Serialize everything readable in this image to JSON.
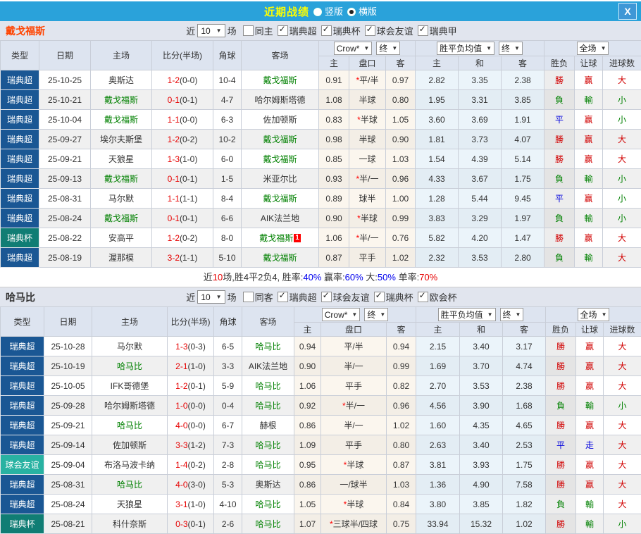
{
  "topbar": {
    "title": "近期战绩",
    "radio_options": [
      {
        "label": "竖版",
        "selected": false,
        "name": "vertical-layout-radio"
      },
      {
        "label": "横版",
        "selected": true,
        "name": "horizontal-layout-radio"
      }
    ],
    "close_glyph": "X"
  },
  "colors": {
    "topbar_bg": "#2aa2da",
    "title_yellow": "#ffff00",
    "focus_team_green": "#008000",
    "score_red": "#e60000",
    "league_bg": {
      "瑞典超": "#1a5794",
      "瑞典杯": "#107d74",
      "球会友谊": "#28b2a2"
    },
    "glyph_colors": {
      "勝": "#d10000",
      "負": "#008000",
      "平": "#0000dd",
      "赢": "#d10000",
      "輸": "#008000",
      "走": "#0000dd",
      "大": "#d10000",
      "小": "#008000"
    }
  },
  "sections": [
    {
      "team": "戴戈福斯",
      "team_color": "#ff4400",
      "filter": {
        "near_label": "近",
        "count": "10",
        "unit_label": "场",
        "same_option": {
          "label": "同主",
          "checked": false
        },
        "leagues": [
          {
            "label": "瑞典超",
            "checked": true
          },
          {
            "label": "瑞典杯",
            "checked": true
          },
          {
            "label": "球会友谊",
            "checked": true
          },
          {
            "label": "瑞典甲",
            "checked": true
          }
        ]
      },
      "header": {
        "columns": [
          "类型",
          "日期",
          "主场",
          "比分(半场)",
          "角球",
          "客场"
        ],
        "groups": [
          {
            "dropdowns": [
              "Crow*",
              "终"
            ]
          },
          {
            "dropdowns": [
              "胜平负均值",
              "终"
            ]
          },
          {
            "dropdowns": [
              "全场"
            ]
          }
        ],
        "sub_columns": [
          "主",
          "盘口",
          "客",
          "主",
          "和",
          "客",
          "胜负",
          "让球",
          "进球数"
        ]
      },
      "rows": [
        {
          "league": "瑞典超",
          "date": "25-10-25",
          "home": "奥斯达",
          "home_focus": false,
          "score": "1-2",
          "half": "(0-0)",
          "corner": "10-4",
          "away": "戴戈福斯",
          "away_focus": true,
          "odds_home": "0.91",
          "handicap_star": true,
          "handicap": "平/半",
          "odds_away": "0.97",
          "avg_home": "2.82",
          "avg_draw": "3.35",
          "avg_away": "2.38",
          "result": "勝",
          "handicap_result": "赢",
          "goals": "大"
        },
        {
          "league": "瑞典超",
          "date": "25-10-21",
          "home": "戴戈福斯",
          "home_focus": true,
          "score": "0-1",
          "half": "(0-1)",
          "corner": "4-7",
          "away": "哈尔姆斯塔德",
          "away_focus": false,
          "odds_home": "1.08",
          "handicap_star": false,
          "handicap": "半球",
          "odds_away": "0.80",
          "avg_home": "1.95",
          "avg_draw": "3.31",
          "avg_away": "3.85",
          "result": "負",
          "handicap_result": "輸",
          "goals": "小"
        },
        {
          "league": "瑞典超",
          "date": "25-10-04",
          "home": "戴戈福斯",
          "home_focus": true,
          "score": "1-1",
          "half": "(0-0)",
          "corner": "6-3",
          "away": "佐加顿斯",
          "away_focus": false,
          "odds_home": "0.83",
          "handicap_star": true,
          "handicap": "半球",
          "odds_away": "1.05",
          "avg_home": "3.60",
          "avg_draw": "3.69",
          "avg_away": "1.91",
          "result": "平",
          "handicap_result": "赢",
          "goals": "小"
        },
        {
          "league": "瑞典超",
          "date": "25-09-27",
          "home": "埃尔夫斯堡",
          "home_focus": false,
          "score": "1-2",
          "half": "(0-2)",
          "corner": "10-2",
          "away": "戴戈福斯",
          "away_focus": true,
          "odds_home": "0.98",
          "handicap_star": false,
          "handicap": "半球",
          "odds_away": "0.90",
          "avg_home": "1.81",
          "avg_draw": "3.73",
          "avg_away": "4.07",
          "result": "勝",
          "handicap_result": "赢",
          "goals": "大"
        },
        {
          "league": "瑞典超",
          "date": "25-09-21",
          "home": "天狼星",
          "home_focus": false,
          "score": "1-3",
          "half": "(1-0)",
          "corner": "6-0",
          "away": "戴戈福斯",
          "away_focus": true,
          "odds_home": "0.85",
          "handicap_star": false,
          "handicap": "一球",
          "odds_away": "1.03",
          "avg_home": "1.54",
          "avg_draw": "4.39",
          "avg_away": "5.14",
          "result": "勝",
          "handicap_result": "赢",
          "goals": "大"
        },
        {
          "league": "瑞典超",
          "date": "25-09-13",
          "home": "戴戈福斯",
          "home_focus": true,
          "score": "0-1",
          "half": "(0-1)",
          "corner": "1-5",
          "away": "米亚尔比",
          "away_focus": false,
          "odds_home": "0.93",
          "handicap_star": true,
          "handicap": "半/一",
          "odds_away": "0.96",
          "avg_home": "4.33",
          "avg_draw": "3.67",
          "avg_away": "1.75",
          "result": "負",
          "handicap_result": "輸",
          "goals": "小"
        },
        {
          "league": "瑞典超",
          "date": "25-08-31",
          "home": "马尔默",
          "home_focus": false,
          "score": "1-1",
          "half": "(1-1)",
          "corner": "8-4",
          "away": "戴戈福斯",
          "away_focus": true,
          "odds_home": "0.89",
          "handicap_star": false,
          "handicap": "球半",
          "odds_away": "1.00",
          "avg_home": "1.28",
          "avg_draw": "5.44",
          "avg_away": "9.45",
          "result": "平",
          "handicap_result": "赢",
          "goals": "小"
        },
        {
          "league": "瑞典超",
          "date": "25-08-24",
          "home": "戴戈福斯",
          "home_focus": true,
          "score": "0-1",
          "half": "(0-1)",
          "corner": "6-6",
          "away": "AIK法兰地",
          "away_focus": false,
          "odds_home": "0.90",
          "handicap_star": true,
          "handicap": "半球",
          "odds_away": "0.99",
          "avg_home": "3.83",
          "avg_draw": "3.29",
          "avg_away": "1.97",
          "result": "負",
          "handicap_result": "輸",
          "goals": "小"
        },
        {
          "league": "瑞典杯",
          "date": "25-08-22",
          "home": "安高平",
          "home_focus": false,
          "score": "1-2",
          "half": "(0-2)",
          "corner": "8-0",
          "away": "戴戈福斯",
          "away_focus": true,
          "away_badge": "1",
          "odds_home": "1.06",
          "handicap_star": true,
          "handicap": "半/一",
          "odds_away": "0.76",
          "avg_home": "5.82",
          "avg_draw": "4.20",
          "avg_away": "1.47",
          "result": "勝",
          "handicap_result": "赢",
          "goals": "大"
        },
        {
          "league": "瑞典超",
          "date": "25-08-19",
          "home": "渥那模",
          "home_focus": false,
          "score": "3-2",
          "half": "(1-1)",
          "corner": "5-10",
          "away": "戴戈福斯",
          "away_focus": true,
          "odds_home": "0.87",
          "handicap_star": false,
          "handicap": "平手",
          "odds_away": "1.02",
          "avg_home": "2.32",
          "avg_draw": "3.53",
          "avg_away": "2.80",
          "result": "負",
          "handicap_result": "輸",
          "goals": "大"
        }
      ],
      "summary": {
        "parts": [
          {
            "text": "近",
            "color": "#333333"
          },
          {
            "text": "10",
            "color": "#e60000"
          },
          {
            "text": "场,胜4平2负4, 胜率:",
            "color": "#333333"
          },
          {
            "text": "40%",
            "color": "#0000ee"
          },
          {
            "text": " 赢率:",
            "color": "#333333"
          },
          {
            "text": "60%",
            "color": "#0000ee"
          },
          {
            "text": " 大:",
            "color": "#333333"
          },
          {
            "text": "50%",
            "color": "#0000ee"
          },
          {
            "text": " 单率:",
            "color": "#333333"
          },
          {
            "text": "70%",
            "color": "#e60000"
          }
        ]
      }
    },
    {
      "team": "哈马比",
      "team_color": "#333333",
      "filter": {
        "near_label": "近",
        "count": "10",
        "unit_label": "场",
        "same_option": {
          "label": "同客",
          "checked": false
        },
        "leagues": [
          {
            "label": "瑞典超",
            "checked": true
          },
          {
            "label": "球会友谊",
            "checked": true
          },
          {
            "label": "瑞典杯",
            "checked": true
          },
          {
            "label": "欧会杯",
            "checked": true
          }
        ]
      },
      "header": {
        "columns": [
          "类型",
          "日期",
          "主场",
          "比分(半场)",
          "角球",
          "客场"
        ],
        "groups": [
          {
            "dropdowns": [
              "Crow*",
              "终"
            ]
          },
          {
            "dropdowns": [
              "胜平负均值",
              "终"
            ]
          },
          {
            "dropdowns": [
              "全场"
            ]
          }
        ],
        "sub_columns": [
          "主",
          "盘口",
          "客",
          "主",
          "和",
          "客",
          "胜负",
          "让球",
          "进球数"
        ]
      },
      "rows": [
        {
          "league": "瑞典超",
          "date": "25-10-28",
          "home": "马尔默",
          "home_focus": false,
          "score": "1-3",
          "half": "(0-3)",
          "corner": "6-5",
          "away": "哈马比",
          "away_focus": true,
          "odds_home": "0.94",
          "handicap_star": false,
          "handicap": "平/半",
          "odds_away": "0.94",
          "avg_home": "2.15",
          "avg_draw": "3.40",
          "avg_away": "3.17",
          "result": "勝",
          "handicap_result": "赢",
          "goals": "大"
        },
        {
          "league": "瑞典超",
          "date": "25-10-19",
          "home": "哈马比",
          "home_focus": true,
          "score": "2-1",
          "half": "(1-0)",
          "corner": "3-3",
          "away": "AIK法兰地",
          "away_focus": false,
          "odds_home": "0.90",
          "handicap_star": false,
          "handicap": "半/一",
          "odds_away": "0.99",
          "avg_home": "1.69",
          "avg_draw": "3.70",
          "avg_away": "4.74",
          "result": "勝",
          "handicap_result": "赢",
          "goals": "大"
        },
        {
          "league": "瑞典超",
          "date": "25-10-05",
          "home": "IFK哥德堡",
          "home_focus": false,
          "score": "1-2",
          "half": "(0-1)",
          "corner": "5-9",
          "away": "哈马比",
          "away_focus": true,
          "odds_home": "1.06",
          "handicap_star": false,
          "handicap": "平手",
          "odds_away": "0.82",
          "avg_home": "2.70",
          "avg_draw": "3.53",
          "avg_away": "2.38",
          "result": "勝",
          "handicap_result": "赢",
          "goals": "大"
        },
        {
          "league": "瑞典超",
          "date": "25-09-28",
          "home": "哈尔姆斯塔德",
          "home_focus": false,
          "score": "1-0",
          "half": "(0-0)",
          "corner": "0-4",
          "away": "哈马比",
          "away_focus": true,
          "odds_home": "0.92",
          "handicap_star": true,
          "handicap": "半/一",
          "odds_away": "0.96",
          "avg_home": "4.56",
          "avg_draw": "3.90",
          "avg_away": "1.68",
          "result": "負",
          "handicap_result": "輸",
          "goals": "小"
        },
        {
          "league": "瑞典超",
          "date": "25-09-21",
          "home": "哈马比",
          "home_focus": true,
          "score": "4-0",
          "half": "(0-0)",
          "corner": "6-7",
          "away": "赫根",
          "away_focus": false,
          "odds_home": "0.86",
          "handicap_star": false,
          "handicap": "半/一",
          "odds_away": "1.02",
          "avg_home": "1.60",
          "avg_draw": "4.35",
          "avg_away": "4.65",
          "result": "勝",
          "handicap_result": "赢",
          "goals": "大"
        },
        {
          "league": "瑞典超",
          "date": "25-09-14",
          "home": "佐加顿斯",
          "home_focus": false,
          "score": "3-3",
          "half": "(1-2)",
          "corner": "7-3",
          "away": "哈马比",
          "away_focus": true,
          "odds_home": "1.09",
          "handicap_star": false,
          "handicap": "平手",
          "odds_away": "0.80",
          "avg_home": "2.63",
          "avg_draw": "3.40",
          "avg_away": "2.53",
          "result": "平",
          "handicap_result": "走",
          "goals": "大"
        },
        {
          "league": "球会友谊",
          "date": "25-09-04",
          "home": "布洛马波卡纳",
          "home_focus": false,
          "score": "1-4",
          "half": "(0-2)",
          "corner": "2-8",
          "away": "哈马比",
          "away_focus": true,
          "odds_home": "0.95",
          "handicap_star": true,
          "handicap": "半球",
          "odds_away": "0.87",
          "avg_home": "3.81",
          "avg_draw": "3.93",
          "avg_away": "1.75",
          "result": "勝",
          "handicap_result": "赢",
          "goals": "大"
        },
        {
          "league": "瑞典超",
          "date": "25-08-31",
          "home": "哈马比",
          "home_focus": true,
          "score": "4-0",
          "half": "(3-0)",
          "corner": "5-3",
          "away": "奥斯达",
          "away_focus": false,
          "odds_home": "0.86",
          "handicap_star": false,
          "handicap": "一/球半",
          "odds_away": "1.03",
          "avg_home": "1.36",
          "avg_draw": "4.90",
          "avg_away": "7.58",
          "result": "勝",
          "handicap_result": "赢",
          "goals": "大"
        },
        {
          "league": "瑞典超",
          "date": "25-08-24",
          "home": "天狼星",
          "home_focus": false,
          "score": "3-1",
          "half": "(1-0)",
          "corner": "4-10",
          "away": "哈马比",
          "away_focus": true,
          "odds_home": "1.05",
          "handicap_star": true,
          "handicap": "半球",
          "odds_away": "0.84",
          "avg_home": "3.80",
          "avg_draw": "3.85",
          "avg_away": "1.82",
          "result": "負",
          "handicap_result": "輸",
          "goals": "大"
        },
        {
          "league": "瑞典杯",
          "date": "25-08-21",
          "home": "科什奈斯",
          "home_focus": false,
          "score": "0-3",
          "half": "(0-1)",
          "corner": "2-6",
          "away": "哈马比",
          "away_focus": true,
          "odds_home": "1.07",
          "handicap_star": true,
          "handicap": "三球半/四球",
          "odds_away": "0.75",
          "avg_home": "33.94",
          "avg_draw": "15.32",
          "avg_away": "1.02",
          "result": "勝",
          "handicap_result": "輸",
          "goals": "小"
        }
      ],
      "summary": null
    }
  ]
}
